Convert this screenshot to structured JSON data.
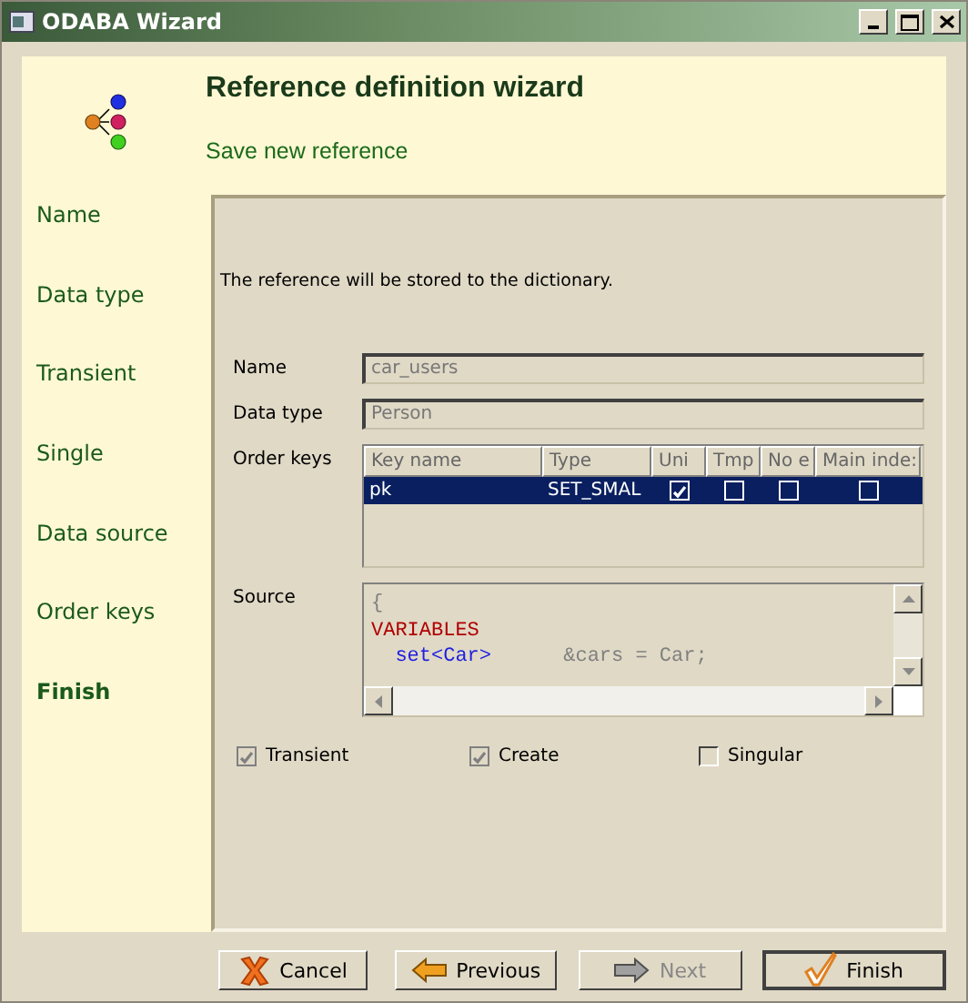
{
  "window": {
    "title": "ODABA Wizard"
  },
  "header": {
    "title": "Reference definition wizard",
    "subtitle": "Save new reference"
  },
  "steps": [
    {
      "label": "Name",
      "selected": false
    },
    {
      "label": "Data type",
      "selected": false
    },
    {
      "label": "Transient",
      "selected": false
    },
    {
      "label": "Single",
      "selected": false
    },
    {
      "label": "Data source",
      "selected": false
    },
    {
      "label": "Order keys",
      "selected": false
    },
    {
      "label": "Finish",
      "selected": true
    }
  ],
  "message": "The reference will be stored to the dictionary.",
  "fields": [
    {
      "label": "Name",
      "value": "car_users"
    },
    {
      "label": "Data type",
      "value": "Person"
    }
  ],
  "order_keys": {
    "label": "Order keys",
    "columns": [
      "Key name",
      "Type",
      "Uni",
      "Tmp",
      "No e",
      "Main inde:"
    ],
    "rows": [
      {
        "key_name": "pk",
        "type": "SET_SMAL",
        "flags": [
          true,
          false,
          false,
          false
        ],
        "selected": true
      }
    ]
  },
  "source": {
    "label": "Source",
    "lines": [
      [
        {
          "text": "{",
          "kind": "plain"
        }
      ],
      [
        {
          "text": "VARIABLES",
          "kind": "keyword"
        }
      ],
      [
        {
          "text": "  set<Car>",
          "kind": "type"
        },
        {
          "text": "      &cars = Car;",
          "kind": "plain"
        }
      ]
    ]
  },
  "options": [
    {
      "label": "Transient",
      "checked": true,
      "disabled": true
    },
    {
      "label": "Create",
      "checked": true,
      "disabled": true
    },
    {
      "label": "Singular",
      "checked": false,
      "disabled": false
    }
  ],
  "buttons": [
    {
      "label": "Cancel",
      "kind": "cancel",
      "disabled": false
    },
    {
      "label": "Previous",
      "kind": "previous",
      "disabled": false
    },
    {
      "label": "Next",
      "kind": "next",
      "disabled": true
    },
    {
      "label": "Finish",
      "kind": "finish",
      "disabled": false
    }
  ]
}
